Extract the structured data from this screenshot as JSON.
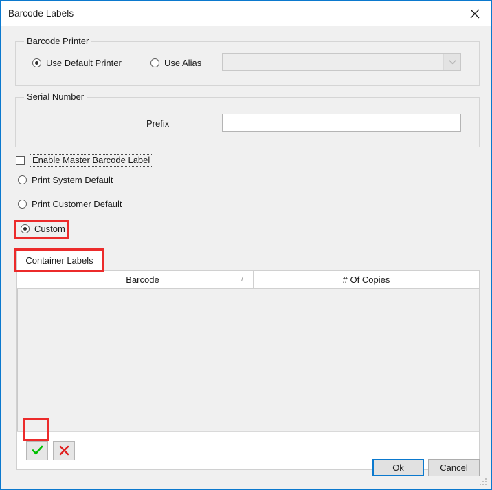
{
  "window": {
    "title": "Barcode Labels",
    "close_icon": "close-icon"
  },
  "printer_group": {
    "legend": "Barcode Printer",
    "options": [
      {
        "label": "Use Default Printer",
        "selected": true
      },
      {
        "label": "Use Alias",
        "selected": false
      }
    ],
    "alias_combo": {
      "value": "",
      "placeholder": "",
      "enabled": false,
      "arrow_icon": "chevron-down-icon"
    }
  },
  "serial_group": {
    "legend": "Serial Number",
    "prefix_label": "Prefix",
    "prefix_value": "",
    "prefix_placeholder": ""
  },
  "label_options": {
    "master_checkbox": {
      "label": "Enable Master Barcode Label",
      "checked": false,
      "focused": true
    },
    "radios": [
      {
        "label": "Print System Default",
        "selected": false
      },
      {
        "label": "Print Customer Default",
        "selected": false
      },
      {
        "label": "Custom",
        "selected": true
      }
    ]
  },
  "tabs": [
    {
      "label": "Container Labels",
      "active": true
    }
  ],
  "grid": {
    "columns": [
      {
        "label": "",
        "name": "row-indicator"
      },
      {
        "label": "Barcode",
        "name": "barcode",
        "sort_indicator": "/"
      },
      {
        "label": "# Of Copies",
        "name": "copies"
      }
    ],
    "rows": [],
    "toolbar": [
      {
        "name": "accept-button",
        "icon": "check-icon",
        "color": "#00c000",
        "highlighted": true
      },
      {
        "name": "cancel-edit-button",
        "icon": "x-icon",
        "color": "#e02020",
        "highlighted": false
      }
    ]
  },
  "footer": {
    "ok_label": "Ok",
    "cancel_label": "Cancel",
    "ok_focused": true,
    "resize_grip": "resize-grip-icon"
  },
  "annotations": {
    "highlight_color": "#ec2b2b",
    "boxes": [
      "custom-radio",
      "container-labels-tab",
      "accept-button"
    ]
  }
}
